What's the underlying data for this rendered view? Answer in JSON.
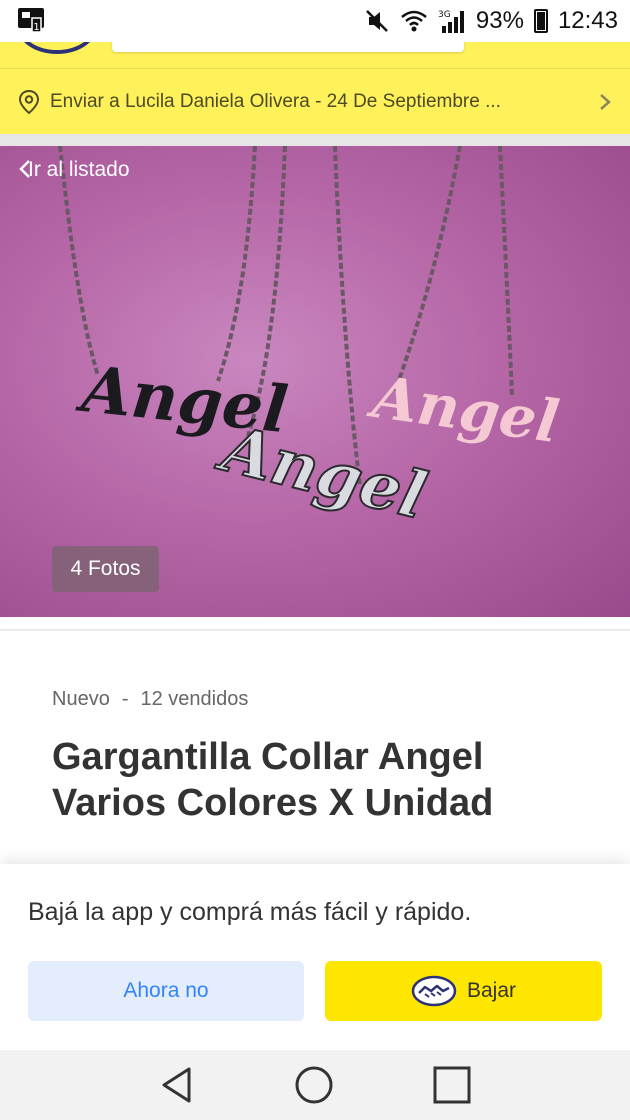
{
  "status_bar": {
    "battery": "93%",
    "time": "12:43",
    "icons": [
      "notification-icon",
      "mute-icon",
      "wifi-icon",
      "signal-3g-icon",
      "battery-icon"
    ]
  },
  "shipping": {
    "text": "Enviar a Lucila Daniela Olivera - 24 De Septiembre ..."
  },
  "gallery": {
    "back_label": "Ir al listado",
    "photos_count": "4 Fotos",
    "necklace_text": [
      "Angel",
      "Angel",
      "Angel"
    ]
  },
  "product": {
    "condition": "Nuevo",
    "separator": "-",
    "sold": "12 vendidos",
    "title": "Gargantilla Collar Angel Varios Colores X Unidad"
  },
  "app_banner": {
    "message": "Bajá la app y comprá más fácil y rápido.",
    "later_label": "Ahora no",
    "download_label": "Bajar"
  },
  "colors": {
    "brand_yellow": "#fff159",
    "button_yellow": "#ffe600",
    "accent_blue": "#3483fa",
    "brand_navy": "#2d3277"
  }
}
